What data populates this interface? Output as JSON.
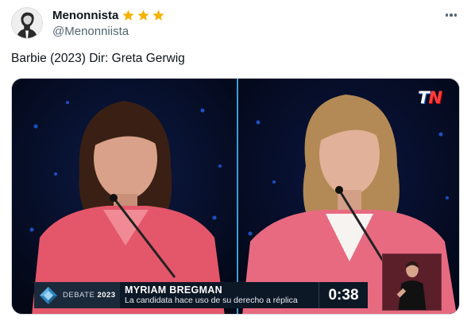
{
  "author": {
    "display_name": "Menonnista",
    "handle": "@Menonniista",
    "rating_stars": 3,
    "avatar_icon": "avatar-portrait",
    "star_color": "#f5b301"
  },
  "menu_icon": "more-horizontal-icon",
  "tweet": {
    "text": "Barbie (2023) Dir: Greta Gerwig"
  },
  "media": {
    "broadcaster_logo": {
      "t": "T",
      "n": "N"
    },
    "lower_third": {
      "brand_prefix": "DEBATE",
      "brand_year": "2023",
      "speaker_name": "MYRIAM BREGMAN",
      "caption": "La candidata hace uso de su derecho a réplica",
      "timer": "0:38"
    },
    "accent_color": "#e8566c",
    "background_color": "#050b22"
  }
}
